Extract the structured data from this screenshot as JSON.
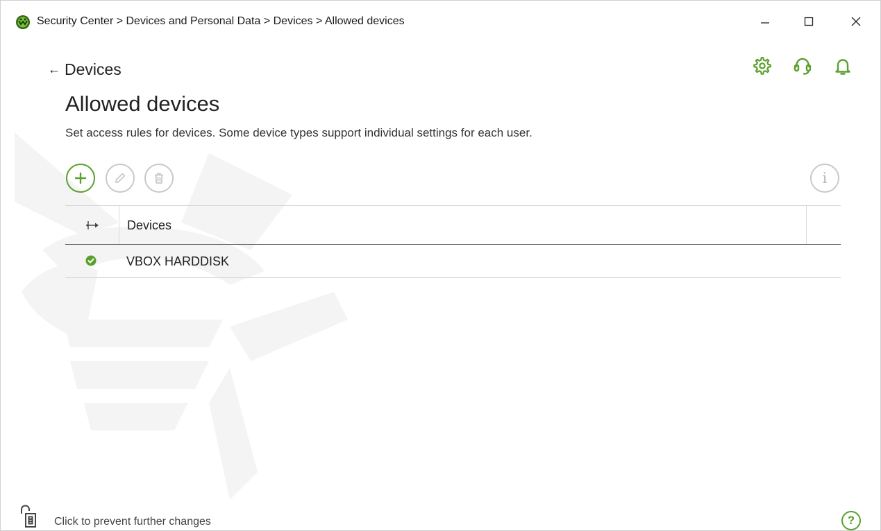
{
  "window": {
    "breadcrumb": "Security Center > Devices and Personal Data > Devices > Allowed devices",
    "app_icon": "dr-web-spider-icon",
    "controls": [
      "minimize-icon",
      "maximize-icon",
      "close-icon"
    ]
  },
  "header_tools": [
    "gear-icon",
    "headset-icon",
    "bell-icon"
  ],
  "back": {
    "arrow": "←",
    "label": "Devices"
  },
  "page": {
    "title": "Allowed devices",
    "description": "Set access rules for devices. Some device types support individual settings for each user."
  },
  "toolbar": {
    "buttons": [
      "plus-icon",
      "pencil-icon",
      "trash-icon"
    ],
    "info_glyph": "i"
  },
  "table": {
    "columns": [
      "Devices"
    ],
    "rows": [
      {
        "status": "allowed",
        "name": "VBOX HARDDISK"
      }
    ]
  },
  "footer": {
    "lock_text": "Click to prevent further changes",
    "help_glyph": "?"
  },
  "colors": {
    "accent": "#5aa02c",
    "disabled": "#c9c9c9",
    "text": "#222222"
  }
}
